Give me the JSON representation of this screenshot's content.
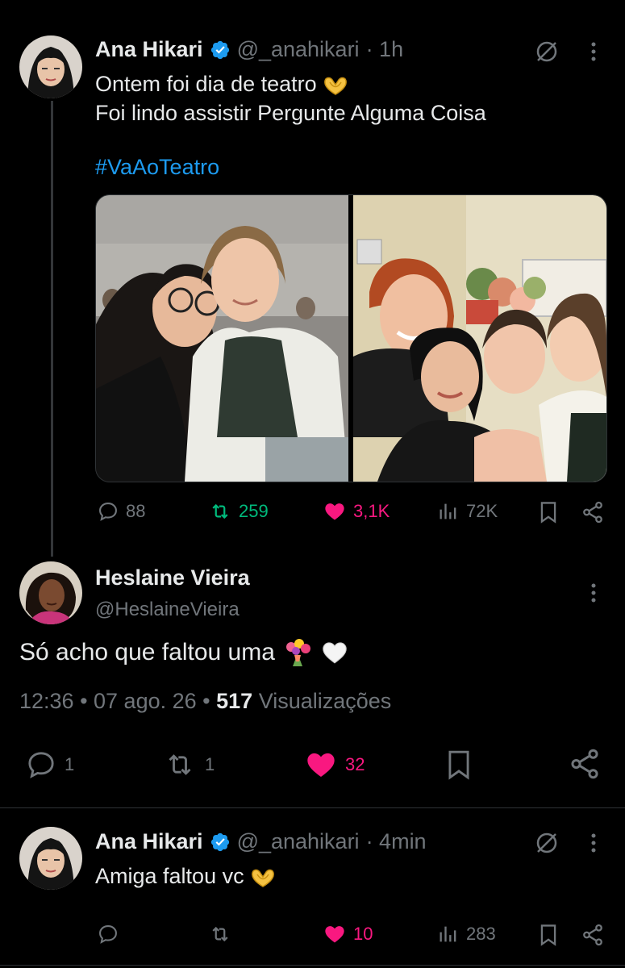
{
  "colors": {
    "accent": "#1d9bf0",
    "like": "#f91880",
    "repost": "#00ba7c",
    "muted": "#71767b",
    "text": "#e7e9ea"
  },
  "post1": {
    "name": "Ana Hikari",
    "handle": "@_anahikari",
    "time": "· 1h",
    "text_line1": "Ontem foi dia de teatro",
    "text_line2": "Foi lindo assistir Pergunte Alguma Coisa",
    "hashtag": "#VaAoTeatro",
    "replies": "88",
    "reposts": "259",
    "likes": "3,1K",
    "views": "72K"
  },
  "post2": {
    "name": "Heslaine Vieira",
    "handle": "@HeslaineVieira",
    "text": "Só acho que faltou uma",
    "timestamp": "12:36 • 07 ago. 26 •",
    "views_count": "517",
    "views_label": "Visualizações",
    "replies": "1",
    "reposts": "1",
    "likes": "32"
  },
  "post3": {
    "name": "Ana Hikari",
    "handle": "@_anahikari",
    "time": "· 4min",
    "text": "Amiga faltou vc",
    "likes": "10",
    "views": "283"
  },
  "icons": [
    "heart-hands-emoji",
    "bouquet-emoji",
    "white-heart-emoji",
    "verified-badge-icon",
    "grok-icon",
    "more-icon",
    "reply-icon",
    "repost-icon",
    "like-icon",
    "views-icon",
    "bookmark-icon",
    "share-icon"
  ]
}
